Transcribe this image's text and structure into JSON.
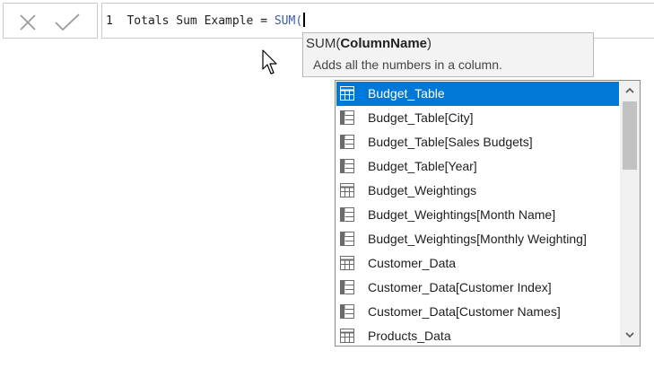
{
  "formula_bar": {
    "line_number": "1",
    "measure_text": "Totals Sum Example = ",
    "function_text": "SUM("
  },
  "tooltip": {
    "signature_prefix": "SUM(",
    "signature_param": "ColumnName",
    "signature_suffix": ")",
    "description": "Adds all the numbers in a column."
  },
  "autocomplete": {
    "items": [
      {
        "label": "Budget_Table",
        "icon": "table-icon",
        "selected": true
      },
      {
        "label": "Budget_Table[City]",
        "icon": "column-icon"
      },
      {
        "label": "Budget_Table[Sales Budgets]",
        "icon": "column-icon"
      },
      {
        "label": "Budget_Table[Year]",
        "icon": "column-icon"
      },
      {
        "label": "Budget_Weightings",
        "icon": "table-icon"
      },
      {
        "label": "Budget_Weightings[Month Name]",
        "icon": "column-icon"
      },
      {
        "label": "Budget_Weightings[Monthly Weighting]",
        "icon": "column-icon"
      },
      {
        "label": "Customer_Data",
        "icon": "table-icon"
      },
      {
        "label": "Customer_Data[Customer Index]",
        "icon": "column-icon"
      },
      {
        "label": "Customer_Data[Customer Names]",
        "icon": "column-icon"
      },
      {
        "label": "Products_Data",
        "icon": "table-icon"
      }
    ]
  },
  "colors": {
    "selection": "#0078d7",
    "function_text": "#3b5ea6"
  }
}
